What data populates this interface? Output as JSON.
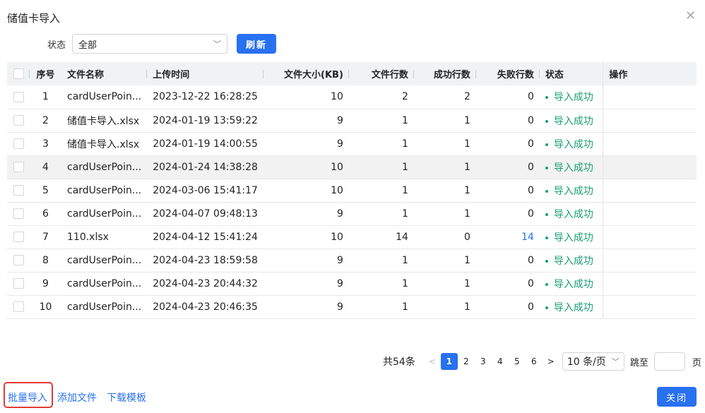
{
  "dialog": {
    "title": "储值卡导入"
  },
  "filter": {
    "label": "状态",
    "value": "全部",
    "refresh_label": "刷新"
  },
  "table": {
    "headers": [
      "序号",
      "文件名称",
      "上传时间",
      "文件大小(KB)",
      "文件行数",
      "成功行数",
      "失败行数",
      "状态",
      "操作"
    ],
    "rows": [
      {
        "no": "1",
        "name": "cardUserPoin...",
        "time": "2023-12-22 16:28:25",
        "size": "10",
        "lines": "2",
        "success": "2",
        "fail": "0",
        "status": "导入成功"
      },
      {
        "no": "2",
        "name": "储值卡导入.xlsx",
        "time": "2024-01-19 13:59:22",
        "size": "9",
        "lines": "1",
        "success": "1",
        "fail": "0",
        "status": "导入成功"
      },
      {
        "no": "3",
        "name": "储值卡导入.xlsx",
        "time": "2024-01-19 14:00:55",
        "size": "9",
        "lines": "1",
        "success": "1",
        "fail": "0",
        "status": "导入成功"
      },
      {
        "no": "4",
        "name": "cardUserPoin...",
        "time": "2024-01-24 14:38:28",
        "size": "10",
        "lines": "1",
        "success": "1",
        "fail": "0",
        "status": "导入成功"
      },
      {
        "no": "5",
        "name": "cardUserPoin...",
        "time": "2024-03-06 15:41:17",
        "size": "10",
        "lines": "1",
        "success": "1",
        "fail": "0",
        "status": "导入成功"
      },
      {
        "no": "6",
        "name": "cardUserPoin...",
        "time": "2024-04-07 09:48:13",
        "size": "9",
        "lines": "1",
        "success": "1",
        "fail": "0",
        "status": "导入成功"
      },
      {
        "no": "7",
        "name": "110.xlsx",
        "time": "2024-04-12 15:41:24",
        "size": "10",
        "lines": "14",
        "success": "0",
        "fail": "14",
        "status": "导入成功"
      },
      {
        "no": "8",
        "name": "cardUserPoin...",
        "time": "2024-04-23 18:59:58",
        "size": "9",
        "lines": "1",
        "success": "1",
        "fail": "0",
        "status": "导入成功"
      },
      {
        "no": "9",
        "name": "cardUserPoin...",
        "time": "2024-04-23 20:44:32",
        "size": "9",
        "lines": "1",
        "success": "1",
        "fail": "0",
        "status": "导入成功"
      },
      {
        "no": "10",
        "name": "cardUserPoin...",
        "time": "2024-04-23 20:46:35",
        "size": "9",
        "lines": "1",
        "success": "1",
        "fail": "0",
        "status": "导入成功"
      }
    ]
  },
  "pagination": {
    "total": "共54条",
    "pages": [
      "1",
      "2",
      "3",
      "4",
      "5",
      "6"
    ],
    "current": "1",
    "prev": "<",
    "next": ">",
    "page_size": "10 条/页",
    "jump_label": "跳至",
    "jump_value": "",
    "page_unit": "页"
  },
  "footer": {
    "batch_import": "批量导入",
    "add_file": "添加文件",
    "download_template": "下载模板",
    "close": "关闭"
  }
}
